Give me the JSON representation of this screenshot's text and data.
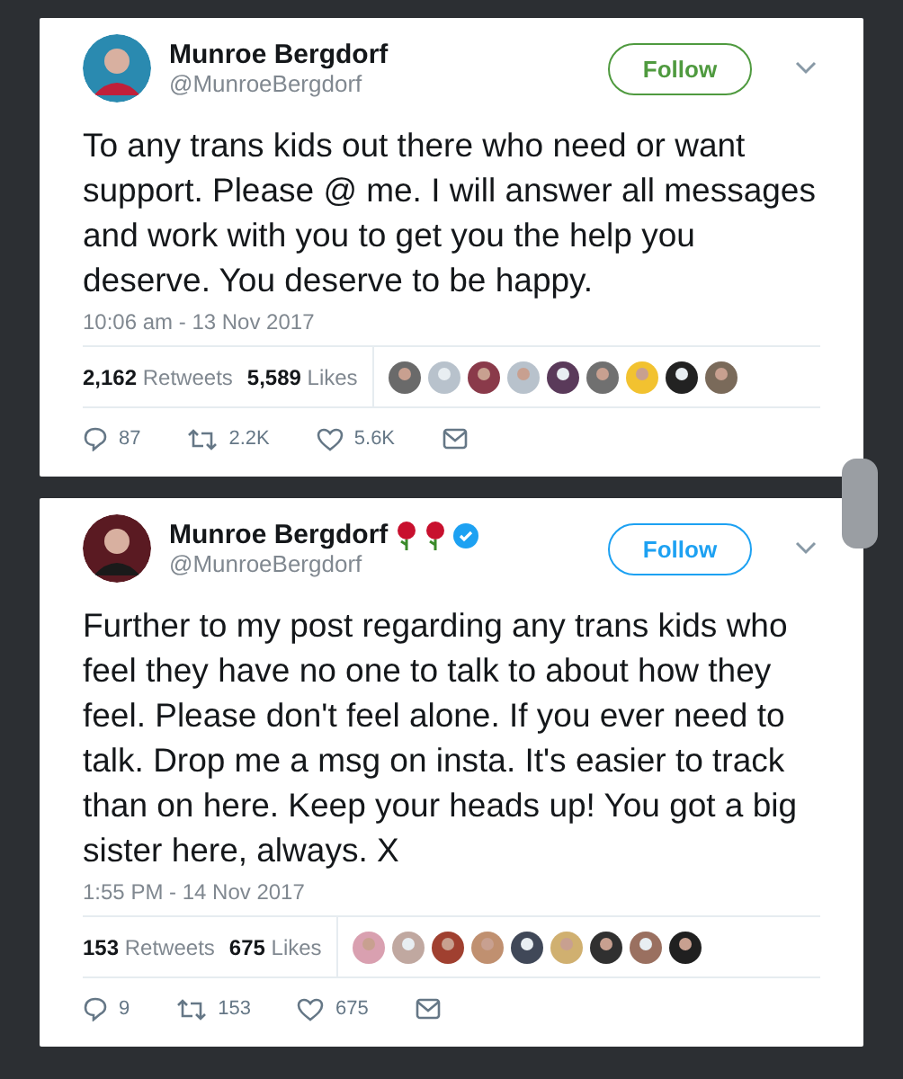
{
  "tweets": [
    {
      "name": "Munroe Bergdorf",
      "handle": "@MunroeBergdorf",
      "verified": false,
      "follow_button": {
        "label": "Follow",
        "color": "#4f9a3f"
      },
      "text": "To any trans kids out there who need or want support. Please @ me. I will answer all messages and work with you to get you the help you deserve. You deserve to be happy.",
      "time": "10:06 am - 13 Nov 2017",
      "retweets": {
        "count": "2,162",
        "label": "Retweets"
      },
      "likes": {
        "count": "5,589",
        "label": "Likes"
      },
      "actions": {
        "replies": "87",
        "retweets": "2.2K",
        "likes": "5.6K"
      }
    },
    {
      "name": "Munroe Bergdorf",
      "handle": "@MunroeBergdorf",
      "name_icons": [
        {
          "kind": "rose"
        },
        {
          "kind": "rose"
        }
      ],
      "verified": true,
      "follow_button": {
        "label": "Follow",
        "color": "#1da1f2"
      },
      "text": "Further to my post regarding any trans kids who feel they have no one to talk to about how they feel. Please don't feel alone. If you ever need to talk. Drop me a msg on insta. It's easier to track than on here. Keep your heads up! You got a big sister here, always. X",
      "time": "1:55 PM - 14 Nov 2017",
      "retweets": {
        "count": "153",
        "label": "Retweets"
      },
      "likes": {
        "count": "675",
        "label": "Likes"
      },
      "actions": {
        "replies": "9",
        "retweets": "153",
        "likes": "675"
      }
    }
  ]
}
